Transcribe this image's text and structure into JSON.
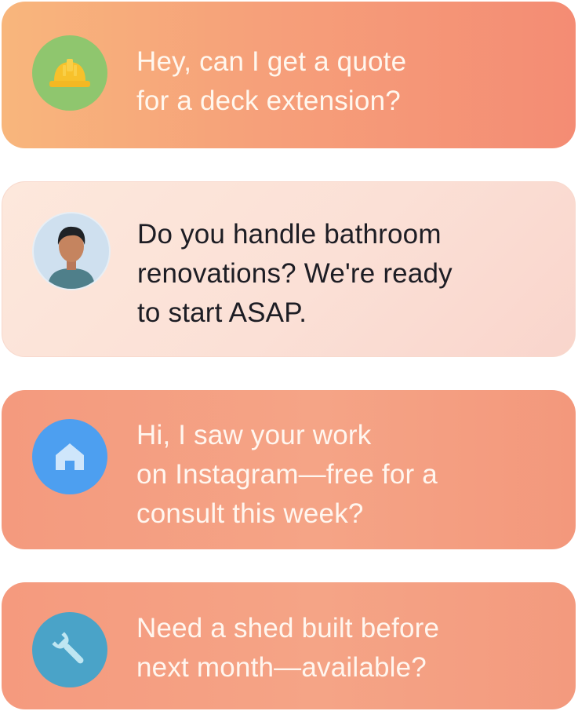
{
  "messages": [
    {
      "icon": "hard-hat-icon",
      "lines": [
        "Hey, can I get a quote",
        "for a deck extension?"
      ]
    },
    {
      "icon": "person-avatar-icon",
      "lines": [
        "Do you handle bathroom",
        "renovations? We're ready",
        "to start ASAP."
      ]
    },
    {
      "icon": "house-icon",
      "lines": [
        "Hi, I saw your work",
        "on Instagram—free for a",
        "consult this week?"
      ]
    },
    {
      "icon": "wrench-icon",
      "lines": [
        "Need a shed built before",
        "next month—available?"
      ]
    }
  ],
  "colors": {
    "card1": "#f6a07a",
    "card2": "#fbe0d6",
    "card3": "#f5a486",
    "card4": "#f5a486",
    "hard_hat_bg": "#8fc66e",
    "hard_hat": "#f7c12b",
    "house_bg": "#4d9ff0",
    "wrench_bg": "#4aa3c8"
  }
}
